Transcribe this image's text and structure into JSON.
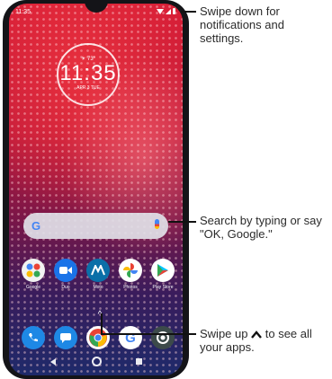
{
  "status_bar": {
    "time": "11:35"
  },
  "clock_widget": {
    "weather": "☀ 73°",
    "time": "11:35",
    "date": "APR 3 TUE"
  },
  "search_bar": {
    "logo": "G"
  },
  "apps": [
    {
      "label": "Google",
      "icon": "google-folder-icon",
      "color": "#f2f2f2"
    },
    {
      "label": "Duo",
      "icon": "duo-icon",
      "color": "#1a73e8"
    },
    {
      "label": "Moto",
      "icon": "moto-icon",
      "color": "#0b6fa8"
    },
    {
      "label": "Photos",
      "icon": "photos-icon",
      "color": "#ffffff"
    },
    {
      "label": "Play Store",
      "icon": "play-store-icon",
      "color": "#ffffff"
    }
  ],
  "dock": [
    {
      "icon": "phone-icon",
      "color": "#1e88e5"
    },
    {
      "icon": "messages-icon",
      "color": "#1e88e5"
    },
    {
      "icon": "chrome-icon",
      "color": "#ffffff"
    },
    {
      "icon": "google-icon",
      "color": "#ffffff"
    },
    {
      "icon": "camera-icon",
      "color": "#3c4a4a"
    }
  ],
  "callouts": {
    "notifications": "Swipe down for notifications and settings.",
    "search": "Search by typing or say \"OK, Google.\"",
    "apps_prefix": "Swipe up",
    "apps_suffix": "to see all your apps."
  }
}
